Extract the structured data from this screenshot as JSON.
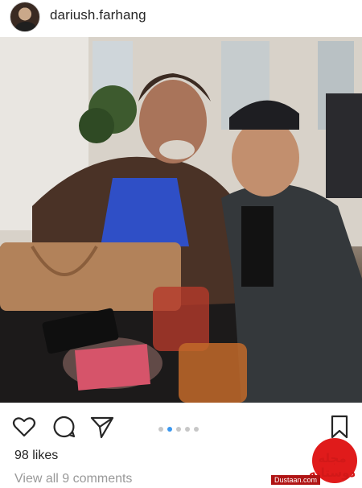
{
  "post": {
    "username": "dariush.farhang",
    "avatar_icon": "profile-avatar",
    "likes": "98 likes",
    "comments_link": "View all 9 comments",
    "carousel": {
      "total": 5,
      "active_index": 1
    }
  },
  "actions": {
    "like_icon": "heart-icon",
    "comment_icon": "comment-bubble-icon",
    "share_icon": "paper-plane-icon",
    "save_icon": "bookmark-icon"
  },
  "watermark": {
    "logo_text": "مجله دوستانه",
    "url": "Dustaan.com"
  },
  "colors": {
    "text": "#262626",
    "muted": "#999999",
    "carousel_active": "#3897f0",
    "carousel_inactive": "#c7c7c7",
    "watermark_red": "#e01b1b"
  }
}
